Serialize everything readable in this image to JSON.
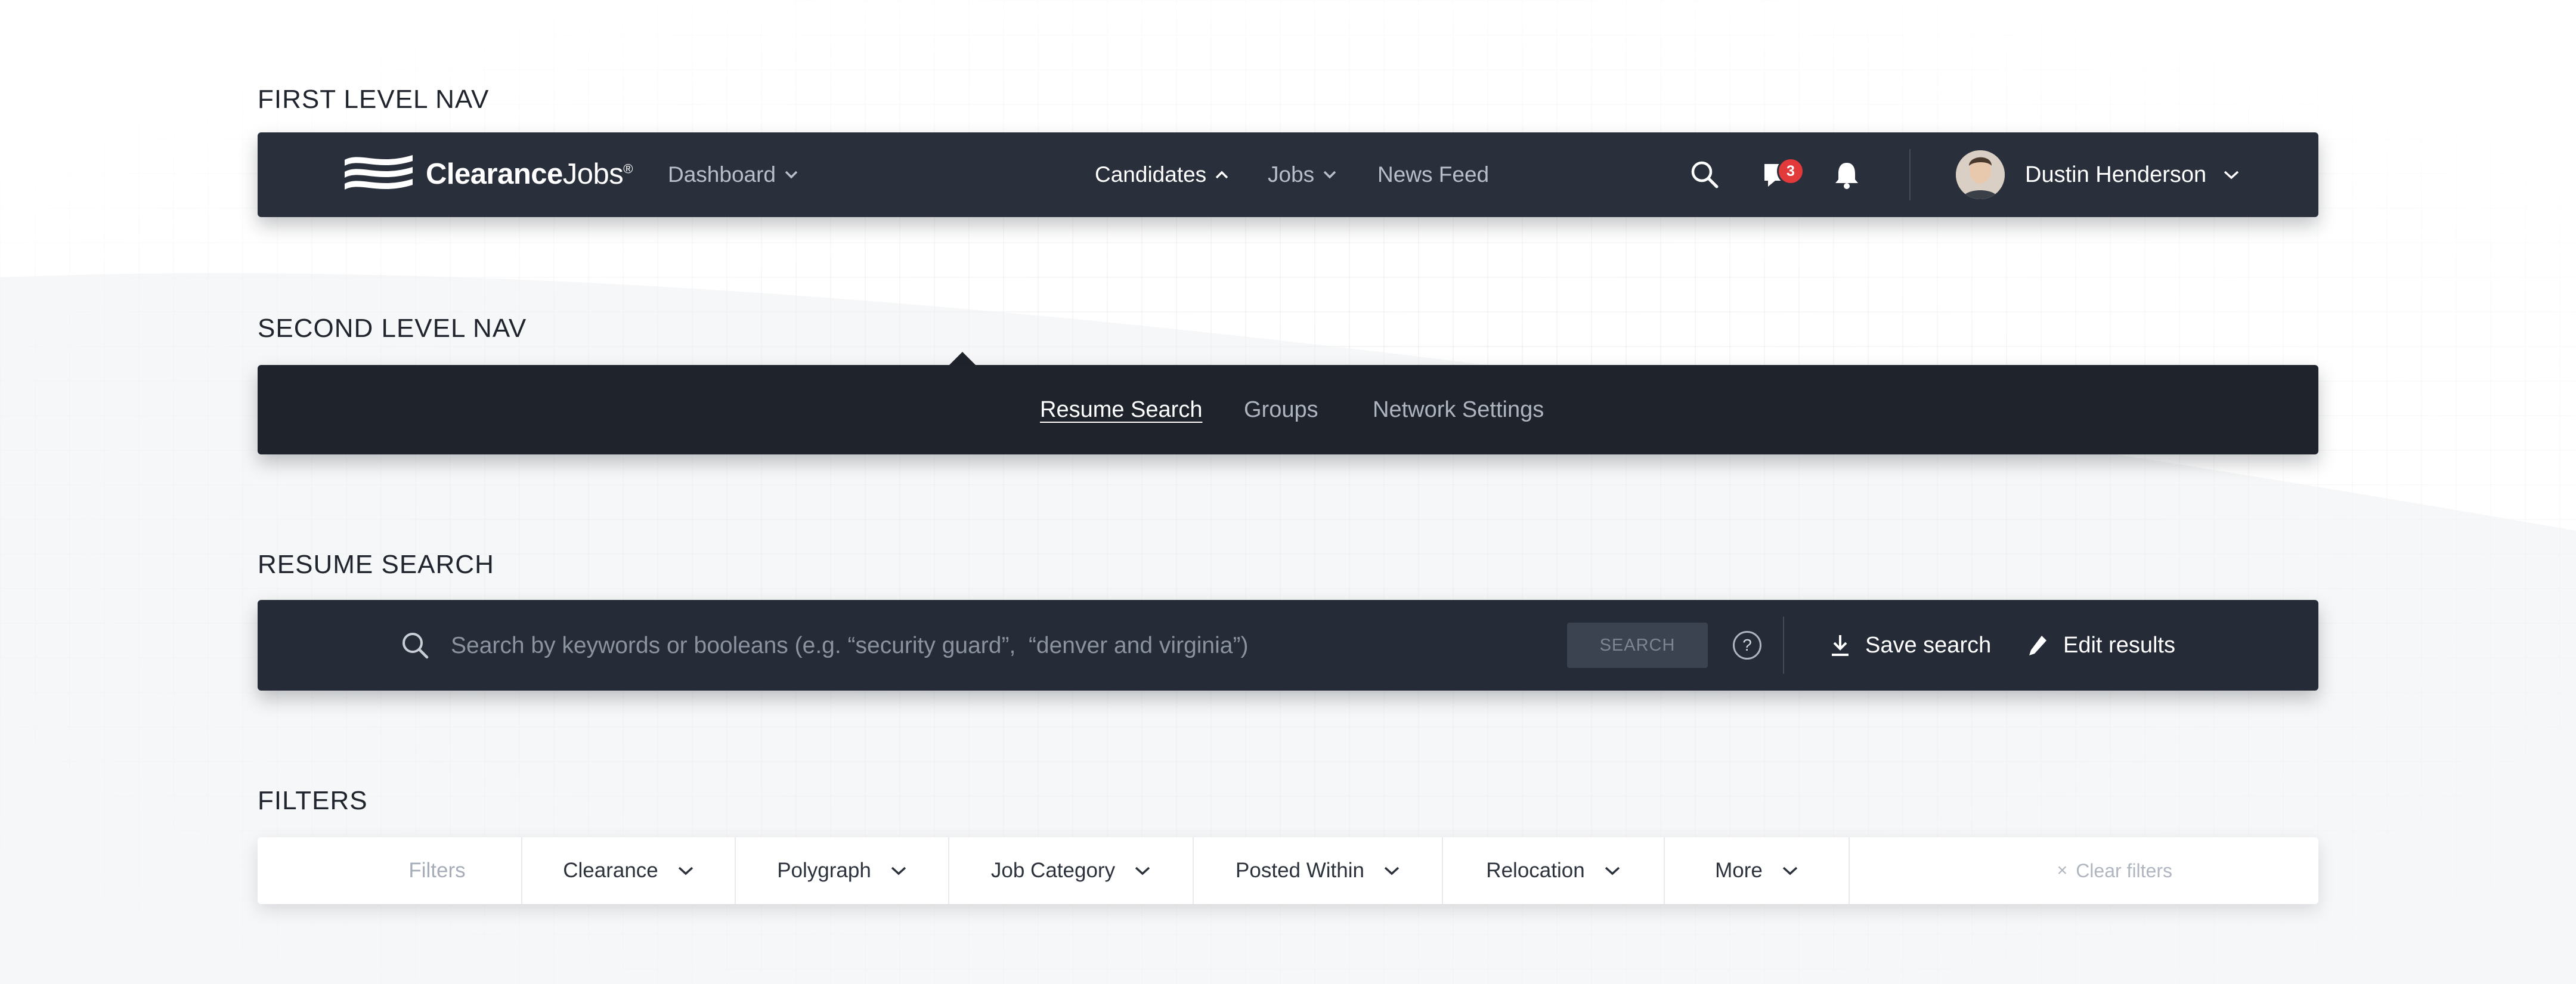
{
  "labels": {
    "first_level_nav": "FIRST LEVEL NAV",
    "second_level_nav": "SECOND LEVEL NAV",
    "resume_search": "RESUME SEARCH",
    "filters": "FILTERS"
  },
  "nav1": {
    "logo_bold": "Clearance",
    "logo_regular": "Jobs",
    "logo_mark": "®",
    "items": [
      {
        "label": "Dashboard",
        "icon": "chevron-down-icon"
      },
      {
        "label": "Candidates",
        "icon": "chevron-up-icon"
      },
      {
        "label": "Jobs",
        "icon": "chevron-down-icon"
      },
      {
        "label": "News Feed"
      }
    ],
    "message_count": "3",
    "user_name": "Dustin Henderson"
  },
  "nav2": {
    "items": [
      {
        "label": "Resume Search"
      },
      {
        "label": "Groups"
      },
      {
        "label": "Network Settings"
      }
    ]
  },
  "search": {
    "placeholder": "Search by keywords or booleans (e.g. “security guard”,  “denver and virginia”)",
    "button": "SEARCH",
    "help": "?",
    "save_label": "Save search",
    "edit_label": "Edit results"
  },
  "filters": {
    "label": "Filters",
    "items": [
      {
        "label": "Clearance"
      },
      {
        "label": "Polygraph"
      },
      {
        "label": "Job Category"
      },
      {
        "label": "Posted Within"
      },
      {
        "label": "Relocation"
      },
      {
        "label": "More"
      }
    ],
    "clear_icon": "×",
    "clear_label": "Clear filters"
  },
  "colors": {
    "nav1_bg": "#2a303b",
    "nav2_bg": "#1f242c",
    "badge": "#e2393b"
  }
}
